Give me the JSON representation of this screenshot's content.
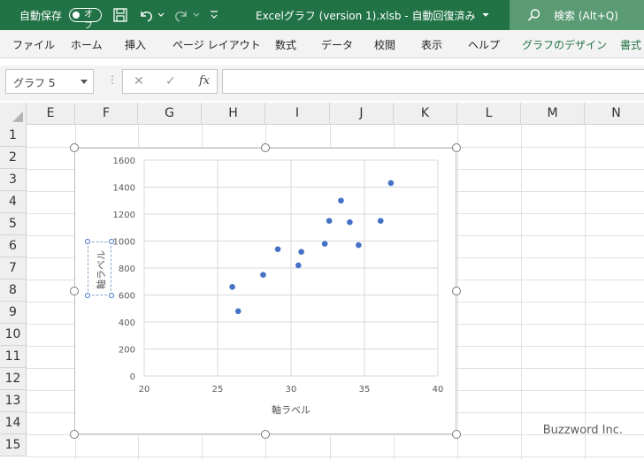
{
  "titlebar": {
    "autosave_label": "自動保存",
    "autosave_state": "オフ",
    "filename": "Excelグラフ (version 1).xlsb  -  自動回復済み",
    "search_label": "検索 (Alt+Q)"
  },
  "ribbon": {
    "tabs": [
      "ファイル",
      "ホーム",
      "挿入",
      "ページ レイアウト",
      "数式",
      "データ",
      "校閲",
      "表示",
      "ヘルプ",
      "グラフのデザイン",
      "書式"
    ]
  },
  "formula_bar": {
    "name_box": "グラフ 5",
    "dots": "⋮",
    "cancel": "✕",
    "enter": "✓",
    "fx": "fx",
    "value": ""
  },
  "sheet": {
    "columns": [
      "E",
      "F",
      "G",
      "H",
      "I",
      "J",
      "K",
      "L",
      "M",
      "N"
    ],
    "rows": [
      "1",
      "2",
      "3",
      "4",
      "5",
      "6",
      "7",
      "8",
      "9",
      "10",
      "11",
      "12",
      "13",
      "14",
      "15"
    ]
  },
  "chart_data": {
    "type": "scatter",
    "title": "",
    "xlabel": "軸ラベル",
    "ylabel": "軸ラベル",
    "xlim": [
      20,
      40
    ],
    "ylim": [
      0,
      1600
    ],
    "xticks": [
      20,
      25,
      30,
      35,
      40
    ],
    "yticks": [
      0,
      200,
      400,
      600,
      800,
      1000,
      1200,
      1400,
      1600
    ],
    "grid": true,
    "marker_color": "#4472c4",
    "points": [
      {
        "x": 26.0,
        "y": 660
      },
      {
        "x": 26.4,
        "y": 480
      },
      {
        "x": 28.1,
        "y": 750
      },
      {
        "x": 29.1,
        "y": 940
      },
      {
        "x": 30.5,
        "y": 820
      },
      {
        "x": 30.7,
        "y": 920
      },
      {
        "x": 32.3,
        "y": 980
      },
      {
        "x": 32.6,
        "y": 1150
      },
      {
        "x": 33.4,
        "y": 1300
      },
      {
        "x": 34.0,
        "y": 1140
      },
      {
        "x": 34.6,
        "y": 970
      },
      {
        "x": 36.1,
        "y": 1150
      },
      {
        "x": 36.8,
        "y": 1430
      }
    ]
  },
  "watermark": "Buzzword Inc."
}
